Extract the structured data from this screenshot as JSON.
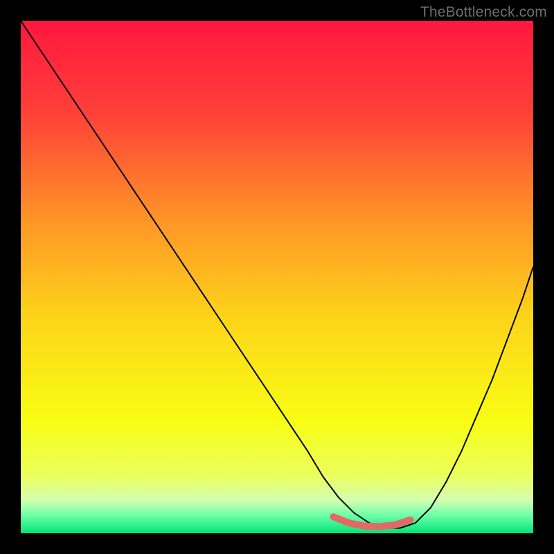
{
  "watermark": "TheBottleneck.com",
  "chart_data": {
    "type": "line",
    "title": "",
    "xlabel": "",
    "ylabel": "",
    "xlim": [
      0,
      100
    ],
    "ylim": [
      0,
      100
    ],
    "grid": false,
    "legend": false,
    "background_gradient_stops": [
      {
        "offset": 0.0,
        "color": "#ff173f"
      },
      {
        "offset": 0.18,
        "color": "#ff4038"
      },
      {
        "offset": 0.4,
        "color": "#fe9926"
      },
      {
        "offset": 0.58,
        "color": "#fdd41a"
      },
      {
        "offset": 0.78,
        "color": "#f8fd13"
      },
      {
        "offset": 0.885,
        "color": "#ecff5a"
      },
      {
        "offset": 0.935,
        "color": "#d4ffb0"
      },
      {
        "offset": 0.965,
        "color": "#6dffa8"
      },
      {
        "offset": 1.0,
        "color": "#00e477"
      }
    ],
    "series": [
      {
        "name": "bottleneck-curve",
        "stroke": "#000000",
        "stroke_width": 2,
        "x": [
          0,
          4,
          8,
          12,
          16,
          20,
          24,
          28,
          32,
          36,
          40,
          44,
          48,
          52,
          56,
          59,
          62,
          65,
          68,
          71,
          74,
          77,
          80,
          83,
          86,
          89,
          92,
          95,
          98,
          100
        ],
        "y": [
          100,
          94,
          88,
          82,
          76,
          70,
          64,
          58,
          52,
          46,
          40,
          34,
          28,
          22,
          16,
          11,
          7,
          4,
          2,
          1,
          1,
          2,
          5,
          10,
          16,
          23,
          30,
          38,
          46,
          52
        ]
      }
    ],
    "highlight_segment": {
      "name": "optimal-range",
      "stroke": "#e36a64",
      "stroke_width": 10,
      "linecap": "round",
      "x": [
        61,
        64,
        67,
        70,
        73,
        76
      ],
      "y": [
        3.2,
        2.0,
        1.4,
        1.3,
        1.6,
        2.6
      ]
    }
  }
}
